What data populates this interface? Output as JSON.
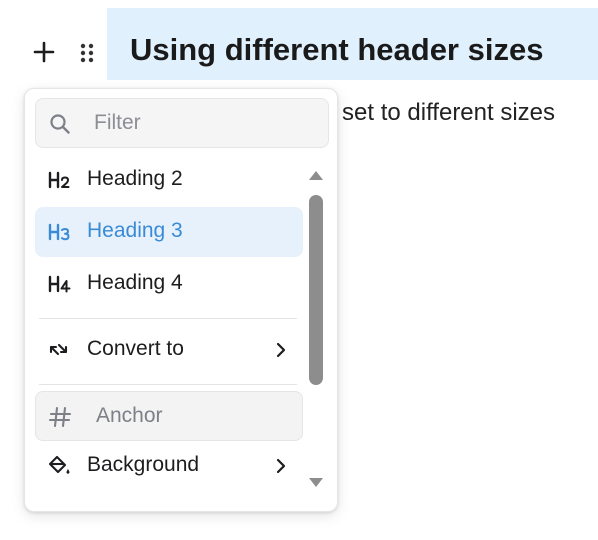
{
  "editor": {
    "heading_text": "Using different header sizes",
    "paragraph_text": "e set to different sizes"
  },
  "block_controls": {
    "add_icon": "plus-icon",
    "drag_icon": "drag-handle-icon"
  },
  "menu": {
    "filter_placeholder": "Filter",
    "items": [
      {
        "label": "Heading 2",
        "icon": "heading-2-icon",
        "state": "normal"
      },
      {
        "label": "Heading 3",
        "icon": "heading-3-icon",
        "state": "active"
      },
      {
        "label": "Heading 4",
        "icon": "heading-4-icon",
        "state": "normal"
      },
      {
        "label": "Convert to",
        "icon": "convert-icon",
        "state": "normal",
        "has_submenu": true
      },
      {
        "label": "Anchor",
        "icon": "hash-icon",
        "state": "disabled"
      },
      {
        "label": "Background",
        "icon": "paint-bucket-icon",
        "state": "normal",
        "has_submenu": true
      }
    ]
  },
  "colors": {
    "heading_bg": "#e1f0fd",
    "active_bg": "#e6f1fc",
    "active_text": "#3a8bd6",
    "scrollbar": "#8d8d8d"
  }
}
